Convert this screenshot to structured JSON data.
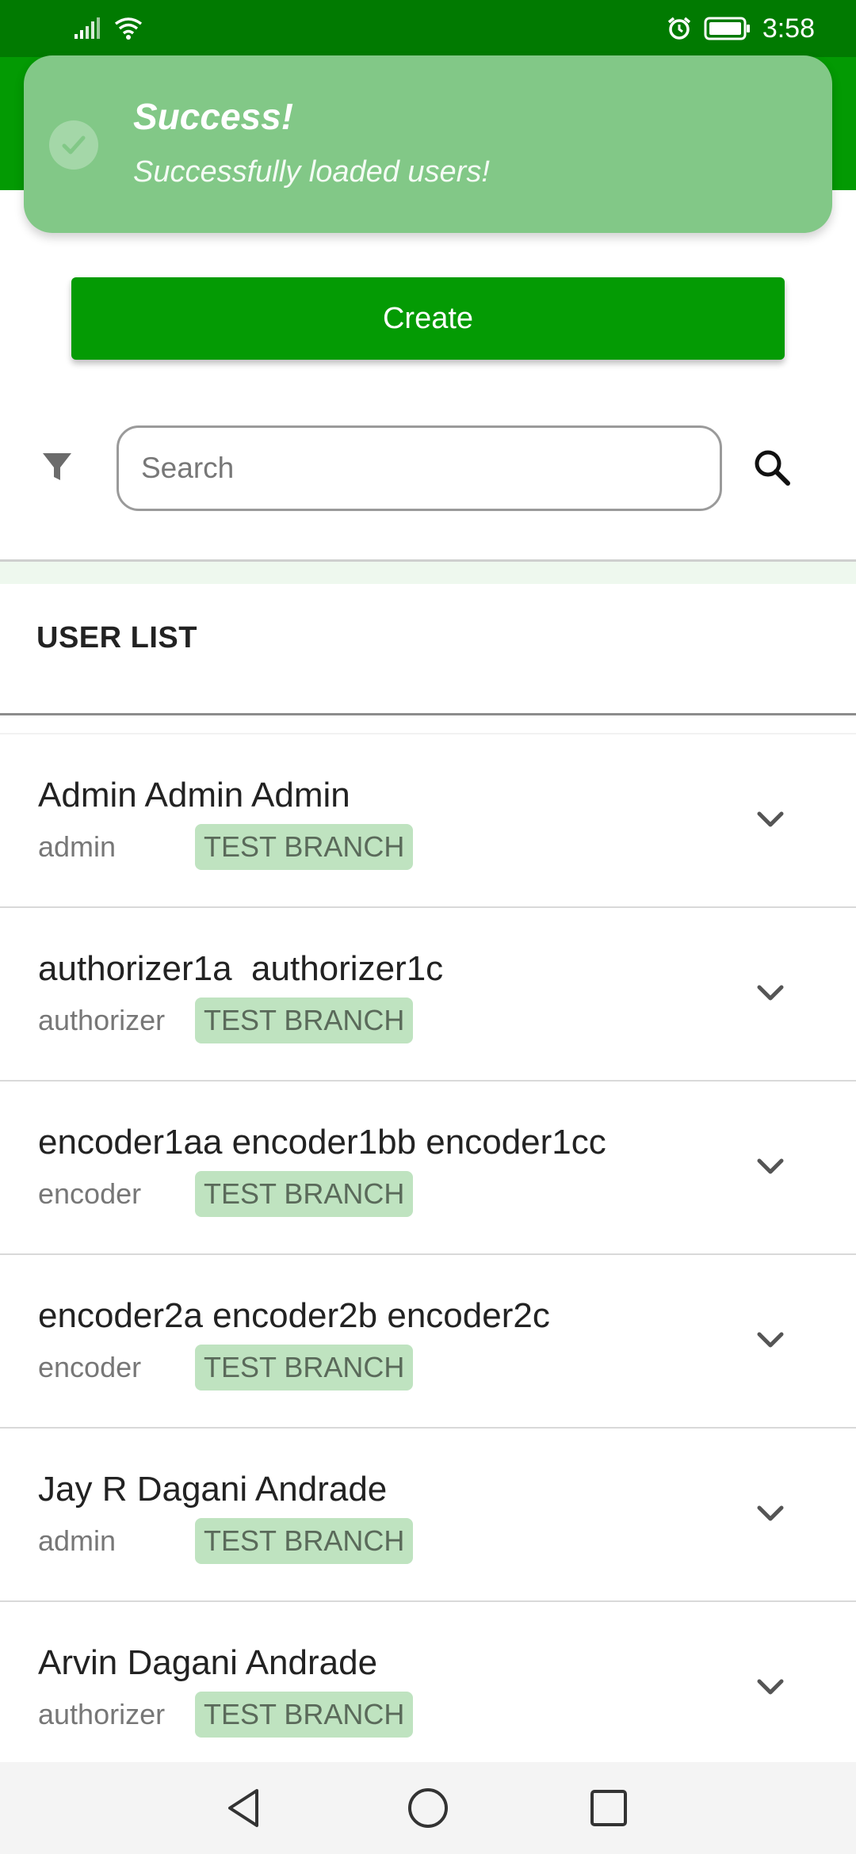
{
  "status_bar": {
    "time": "3:58"
  },
  "toast": {
    "title": "Success!",
    "message": "Successfully loaded users!"
  },
  "actions": {
    "create_label": "Create"
  },
  "search": {
    "placeholder": "Search",
    "value": ""
  },
  "list": {
    "heading": "USER LIST",
    "users": [
      {
        "name": "Admin Admin Admin",
        "role": "admin",
        "branch": "TEST BRANCH"
      },
      {
        "name": "authorizer1a  authorizer1c",
        "role": "authorizer",
        "branch": "TEST BRANCH"
      },
      {
        "name": "encoder1aa encoder1bb encoder1cc",
        "role": "encoder",
        "branch": "TEST BRANCH"
      },
      {
        "name": "encoder2a encoder2b encoder2c",
        "role": "encoder",
        "branch": "TEST BRANCH"
      },
      {
        "name": "Jay R Dagani Andrade",
        "role": "admin",
        "branch": "TEST BRANCH"
      },
      {
        "name": "Arvin Dagani Andrade",
        "role": "authorizer",
        "branch": "TEST BRANCH"
      }
    ]
  },
  "colors": {
    "status_bar": "#017a01",
    "header": "#039a03",
    "toast_bg": "#82c887",
    "primary_button": "#049b04",
    "badge_bg": "#bfe3c0"
  },
  "icons": {
    "status_left": [
      "signal-icon",
      "wifi-icon"
    ],
    "status_right": [
      "alarm-icon",
      "battery-icon"
    ],
    "toast": "check-circle-icon",
    "filter": "filter-icon",
    "search": "search-icon",
    "row_action": "chevron-down-icon",
    "nav": [
      "back-icon",
      "home-icon",
      "recents-icon"
    ]
  }
}
